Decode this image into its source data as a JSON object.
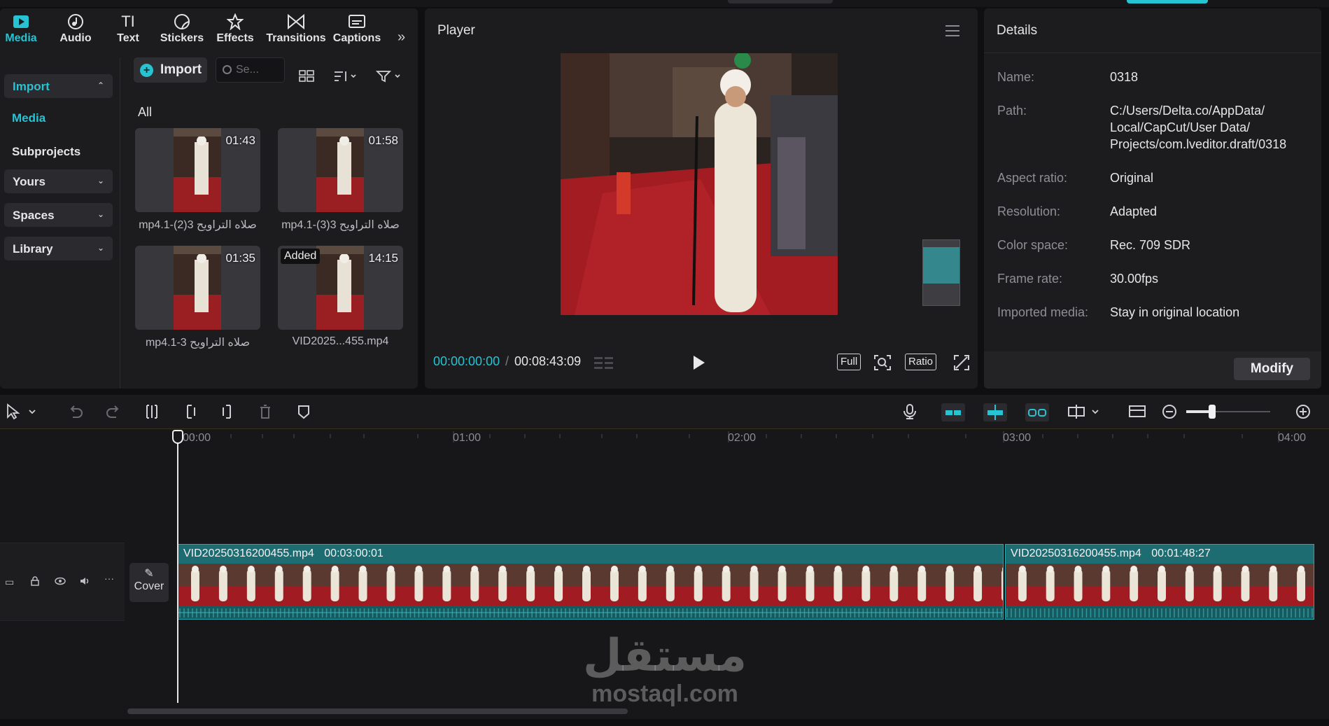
{
  "tabs": [
    {
      "label": "Media",
      "icon": "media-icon",
      "active": true
    },
    {
      "label": "Audio",
      "icon": "audio-icon"
    },
    {
      "label": "Text",
      "icon": "text-icon"
    },
    {
      "label": "Stickers",
      "icon": "stickers-icon"
    },
    {
      "label": "Effects",
      "icon": "effects-icon"
    },
    {
      "label": "Transitions",
      "icon": "transitions-icon"
    },
    {
      "label": "Captions",
      "icon": "captions-icon"
    }
  ],
  "sidebar": {
    "import_label": "Import",
    "media_label": "Media",
    "subprojects_label": "Subprojects",
    "yours_label": "Yours",
    "spaces_label": "Spaces",
    "library_label": "Library"
  },
  "media_toolbar": {
    "import_button": "Import",
    "search_placeholder": "Se...",
    "filter_all": "All"
  },
  "media_items": [
    {
      "name": "صلاه التراويح 3(2)-1.mp4",
      "duration": "01:43",
      "added": false
    },
    {
      "name": "صلاه التراويح 3(3)-1.mp4",
      "duration": "01:58",
      "added": false
    },
    {
      "name": "صلاه التراويح 3-1.mp4",
      "duration": "01:35",
      "added": false
    },
    {
      "name": "VID2025...455.mp4",
      "duration": "14:15",
      "added": true,
      "added_label": "Added"
    }
  ],
  "player": {
    "title": "Player",
    "current_time": "00:00:00:00",
    "separator": "/",
    "total_time": "00:08:43:09",
    "full_label": "Full",
    "ratio_label": "Ratio"
  },
  "details": {
    "title": "Details",
    "rows": [
      {
        "key": "Name:",
        "value": "0318"
      },
      {
        "key": "Path:",
        "value": "C:/Users/Delta.co/AppData/\nLocal/CapCut/User Data/\nProjects/com.lveditor.draft/0318"
      },
      {
        "key": "Aspect ratio:",
        "value": "Original"
      },
      {
        "key": "Resolution:",
        "value": "Adapted"
      },
      {
        "key": "Color space:",
        "value": "Rec. 709 SDR"
      },
      {
        "key": "Frame rate:",
        "value": "30.00fps"
      },
      {
        "key": "Imported media:",
        "value": "Stay in original location"
      }
    ],
    "modify_label": "Modify"
  },
  "timeline": {
    "ruler_labels": [
      "00:00",
      "01:00",
      "02:00",
      "03:00",
      "04:00"
    ],
    "cover_label": "Cover",
    "clips": [
      {
        "name": "VID20250316200455.mp4",
        "duration": "00:03:00:01"
      },
      {
        "name": "VID20250316200455.mp4",
        "duration": "00:01:48:27"
      }
    ]
  },
  "watermark": {
    "arabic": "مستقل",
    "latin": "mostaql.com"
  },
  "colors": {
    "accent": "#27c3d2",
    "clip": "#1a7176",
    "panel": "#1c1c1f"
  }
}
